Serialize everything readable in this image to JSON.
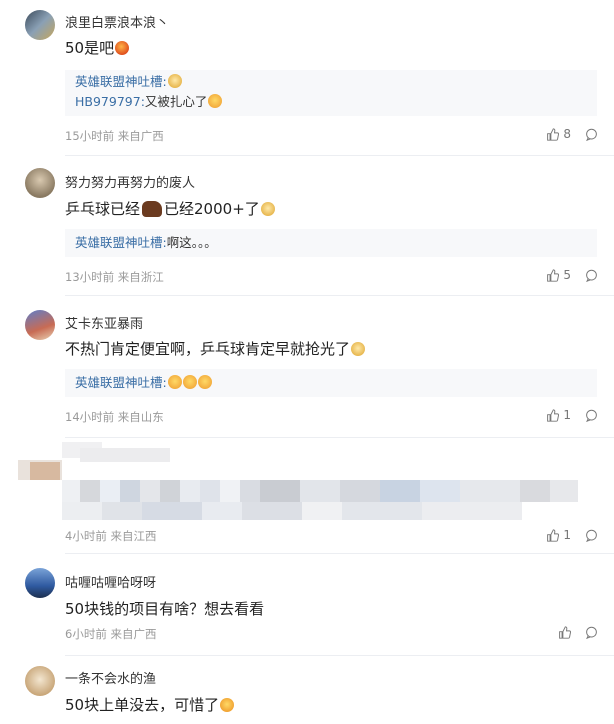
{
  "comments": [
    {
      "username": "浪里白票浪本浪丶",
      "text": "50是吧",
      "reply_author": "英雄联盟神吐槽",
      "reply_text": "",
      "reply2_author": "HB979797",
      "reply2_text": "又被扎心了",
      "time": "15小时前 来自广西",
      "likes": "8"
    },
    {
      "username": "努力努力再努力的废人",
      "text_a": "乒乓球已经",
      "text_b": "已经2000+了",
      "reply_author": "英雄联盟神吐槽",
      "reply_text": "啊这。。。",
      "time": "13小时前 来自浙江",
      "likes": "5"
    },
    {
      "username": "艾卡东亚暴雨",
      "text": "不热门肯定便宜啊，乒乓球肯定早就抢光了",
      "reply_author": "英雄联盟神吐槽",
      "time": "14小时前 来自山东",
      "likes": "1"
    },
    {
      "time": "4小时前 来自江西",
      "likes": "1"
    },
    {
      "username": "咕喱咕喱哈呀呀",
      "text": "50块钱的项目有啥？想去看看",
      "time": "6小时前 来自广西"
    },
    {
      "username": "一条不会水的渔",
      "text": "50块上单没去，可惜了"
    }
  ],
  "colors": {
    "reply_link": "#3a6ea5",
    "meta": "#9a9a9a",
    "reply_bg": "#f7f8fa"
  },
  "icons": [
    "like-icon",
    "comment-icon"
  ]
}
